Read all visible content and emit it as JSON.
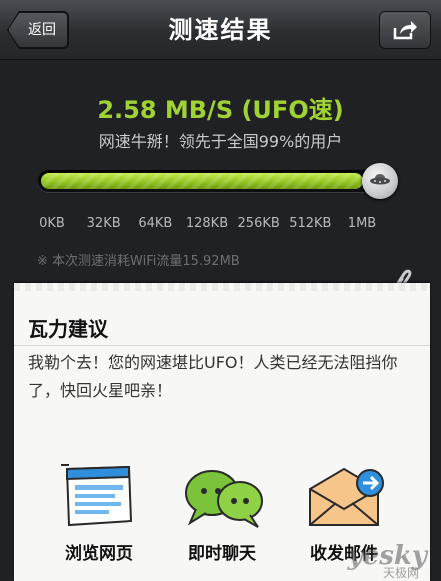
{
  "header": {
    "back_label": "返回",
    "title": "测速结果"
  },
  "result": {
    "speed": "2.58 MB/S (UFO速)",
    "praise": "网速牛掰！领先于全国99%的用户",
    "progress_fraction": 0.92,
    "ticks": [
      "0KB",
      "32KB",
      "64KB",
      "128KB",
      "256KB",
      "512KB",
      "1MB"
    ],
    "usage_note": "※ 本次测速消耗WiFi流量15.92MB"
  },
  "suggestion": {
    "title": "瓦力建议",
    "text": "我勒个去！您的网速堪比UFO！人类已经无法阻挡你了，快回火星吧亲！",
    "actions": [
      {
        "label": "浏览网页",
        "icon": "browser-icon"
      },
      {
        "label": "即时聊天",
        "icon": "chat-bubbles-icon"
      },
      {
        "label": "收发邮件",
        "icon": "mail-icon"
      }
    ]
  },
  "watermark": {
    "brand": "yesky",
    "sub": "天极网"
  },
  "colors": {
    "speed_green": "#9fd232",
    "background": "#1f2124",
    "card": "#f7f7f5"
  }
}
